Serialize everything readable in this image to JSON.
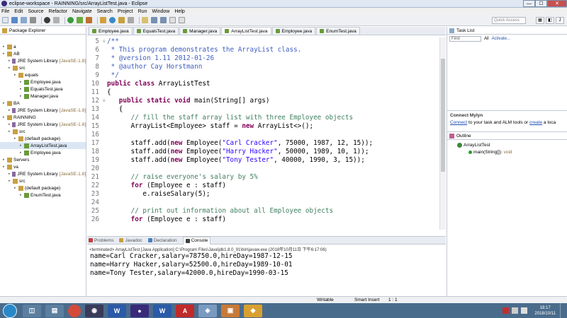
{
  "window": {
    "title": "eclipse-workspace - RAINNING/src/ArrayListTest.java - Eclipse",
    "min": "—",
    "max": "☐",
    "close": "✕"
  },
  "menu": [
    "File",
    "Edit",
    "Source",
    "Refactor",
    "Navigate",
    "Search",
    "Project",
    "Run",
    "Window",
    "Help"
  ],
  "toolbar": {
    "quick_access": "Quick Access"
  },
  "package_explorer": {
    "title": "Package Explorer",
    "items": [
      {
        "label": "a",
        "decoration": ""
      },
      {
        "label": "AB",
        "decoration": ""
      },
      {
        "label": "JRE System Library",
        "decoration": "[JavaSE-1.8]"
      },
      {
        "label": "src",
        "decoration": ""
      },
      {
        "label": "equals",
        "decoration": ""
      },
      {
        "label": "Employee.java",
        "decoration": ""
      },
      {
        "label": "EqualsTest.java",
        "decoration": ""
      },
      {
        "label": "Manager.java",
        "decoration": ""
      },
      {
        "label": "BA",
        "decoration": ""
      },
      {
        "label": "JRE System Library",
        "decoration": "[JavaSE-1.8]"
      },
      {
        "label": "RAINNING",
        "decoration": ""
      },
      {
        "label": "JRE System Library",
        "decoration": "[JavaSE-1.8]"
      },
      {
        "label": "src",
        "decoration": ""
      },
      {
        "label": "(default package)",
        "decoration": ""
      },
      {
        "label": "ArrayListTest.java",
        "decoration": ""
      },
      {
        "label": "Employee.java",
        "decoration": ""
      },
      {
        "label": "Servers",
        "decoration": ""
      },
      {
        "label": "va",
        "decoration": ""
      },
      {
        "label": "JRE System Library",
        "decoration": "[JavaSE-1.8]"
      },
      {
        "label": "src",
        "decoration": ""
      },
      {
        "label": "(default package)",
        "decoration": ""
      },
      {
        "label": "EnumTest.java",
        "decoration": ""
      }
    ]
  },
  "editor": {
    "tabs": [
      "Employee.java",
      "EqualsTest.java",
      "Manager.java",
      "ArrayListTest.java",
      "Employee.java",
      "EnumTest.java"
    ],
    "active_tab": 3,
    "lines": [
      {
        "n": "5",
        "fold": "⊖",
        "html": "<span class=\"jd\">/**</span>"
      },
      {
        "n": "6",
        "fold": "",
        "html": "<span class=\"jd\"> * This program demonstrates the ArrayList class.</span>"
      },
      {
        "n": "7",
        "fold": "",
        "html": "<span class=\"jd\"> * @version 1.11 2012-01-26</span>"
      },
      {
        "n": "8",
        "fold": "",
        "html": "<span class=\"jd\"> * @author Cay Horstmann</span>"
      },
      {
        "n": "9",
        "fold": "",
        "html": "<span class=\"jd\"> */</span>"
      },
      {
        "n": "10",
        "fold": "",
        "html": "<span class=\"kw\">public class</span> ArrayListTest"
      },
      {
        "n": "11",
        "fold": "",
        "html": "{"
      },
      {
        "n": "12",
        "fold": "⊖",
        "html": "   <span class=\"kw\">public static void</span> main(String[] args)"
      },
      {
        "n": "13",
        "fold": "",
        "html": "   {"
      },
      {
        "n": "14",
        "fold": "",
        "html": "      <span class=\"cm\">// fill the staff array list with three Employee objects</span>"
      },
      {
        "n": "15",
        "fold": "",
        "html": "      ArrayList&lt;Employee&gt; staff = <span class=\"kw\">new</span> ArrayList&lt;&gt;();"
      },
      {
        "n": "16",
        "fold": "",
        "html": ""
      },
      {
        "n": "17",
        "fold": "",
        "html": "      staff.add(<span class=\"kw\">new</span> Employee(<span class=\"str\">\"Carl Cracker\"</span>, 75000, 1987, 12, 15));"
      },
      {
        "n": "18",
        "fold": "",
        "html": "      staff.add(<span class=\"kw\">new</span> Employee(<span class=\"str\">\"Harry Hacker\"</span>, 50000, 1989, 10, 1));"
      },
      {
        "n": "19",
        "fold": "",
        "html": "      staff.add(<span class=\"kw\">new</span> Employee(<span class=\"str\">\"Tony Tester\"</span>, 40000, 1990, 3, 15));"
      },
      {
        "n": "20",
        "fold": "",
        "html": ""
      },
      {
        "n": "21",
        "fold": "",
        "html": "      <span class=\"cm\">// raise everyone's salary by 5%</span>"
      },
      {
        "n": "22",
        "fold": "",
        "html": "      <span class=\"kw\">for</span> (Employee e : staff)"
      },
      {
        "n": "23",
        "fold": "",
        "html": "         e.raiseSalary(5);"
      },
      {
        "n": "24",
        "fold": "",
        "html": ""
      },
      {
        "n": "25",
        "fold": "",
        "html": "      <span class=\"cm\">// print out information about all Employee objects</span>"
      },
      {
        "n": "26",
        "fold": "",
        "html": "      <span class=\"kw\">for</span> (Employee e : staff)"
      }
    ]
  },
  "task_list": {
    "title": "Task List",
    "find_placeholder": "Find",
    "all": "All",
    "activate": "Activate..."
  },
  "mylyn": {
    "title": "Connect Mylyn",
    "link1": "Connect",
    "text1": " to your task and ALM tools or ",
    "link2": "create",
    "text2": " a loca"
  },
  "outline": {
    "title": "Outline",
    "class_name": "ArrayListTest",
    "method": "main(String[])",
    "method_type": " : void"
  },
  "bottom_tabs": [
    "Problems",
    "Javadoc",
    "Declaration",
    "Console"
  ],
  "console": {
    "terminated": "<terminated> ArrayListTest [Java Application] C:\\Program Files\\Java\\jdk1.8.0_91\\bin\\javaw.exe (2018年10月11日 下午6:17:06)",
    "output": [
      "name=Carl Cracker,salary=78750.0,hireDay=1987-12-15",
      "name=Harry Hacker,salary=52500.0,hireDay=1989-10-01",
      "name=Tony Tester,salary=42000.0,hireDay=1990-03-15"
    ]
  },
  "status": {
    "writable": "Writable",
    "insert_mode": "Smart Insert",
    "position": "1 : 1"
  },
  "taskbar": {
    "time": "18:17",
    "date": "2018/10/11"
  }
}
